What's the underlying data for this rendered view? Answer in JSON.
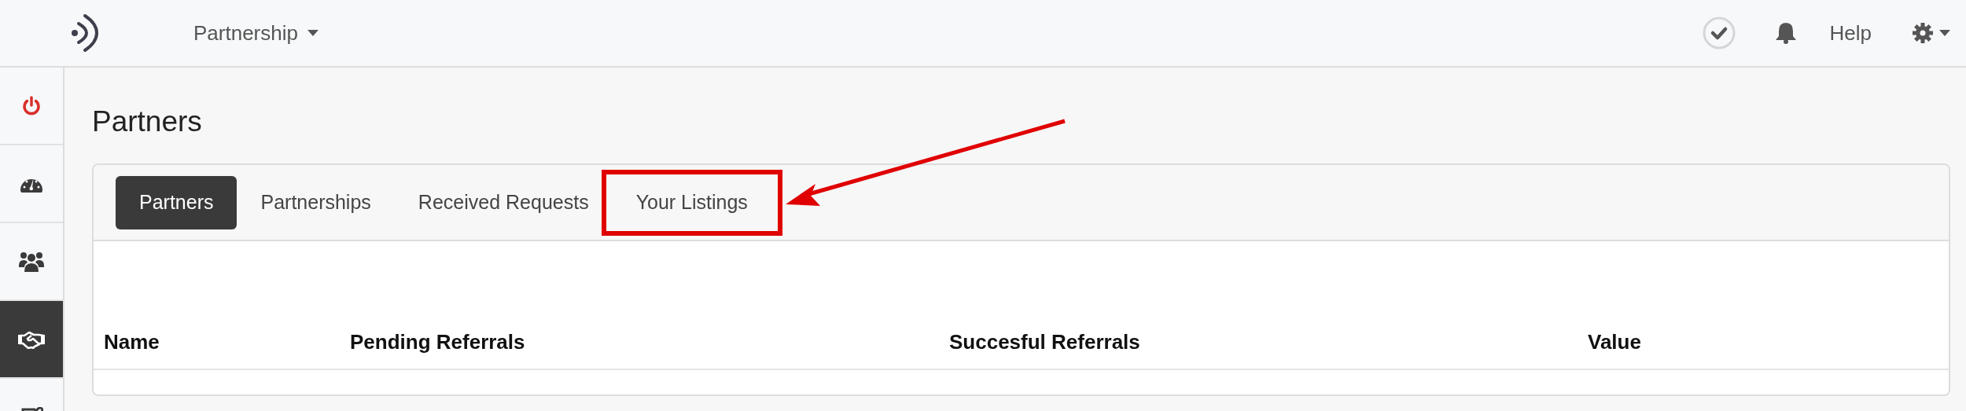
{
  "top_bar": {
    "menu": "Partnership",
    "help": "Help"
  },
  "sidebar": {
    "items": [
      {
        "kind": "power",
        "selected": false
      },
      {
        "kind": "gauge",
        "selected": false
      },
      {
        "kind": "users",
        "selected": false
      },
      {
        "kind": "handshake",
        "selected": true
      },
      {
        "kind": "edit",
        "selected": false
      }
    ]
  },
  "page_title": "Partners",
  "tabs": [
    {
      "label": "Partners",
      "selected": true,
      "highlighted": false
    },
    {
      "label": "Partnerships",
      "selected": false,
      "highlighted": false
    },
    {
      "label": "Received Requests",
      "selected": false,
      "highlighted": false
    },
    {
      "label": "Your Listings",
      "selected": false,
      "highlighted": true
    }
  ],
  "table": {
    "columns": [
      "Name",
      "Pending Referrals",
      "Succesful Referrals",
      "Value"
    ]
  }
}
